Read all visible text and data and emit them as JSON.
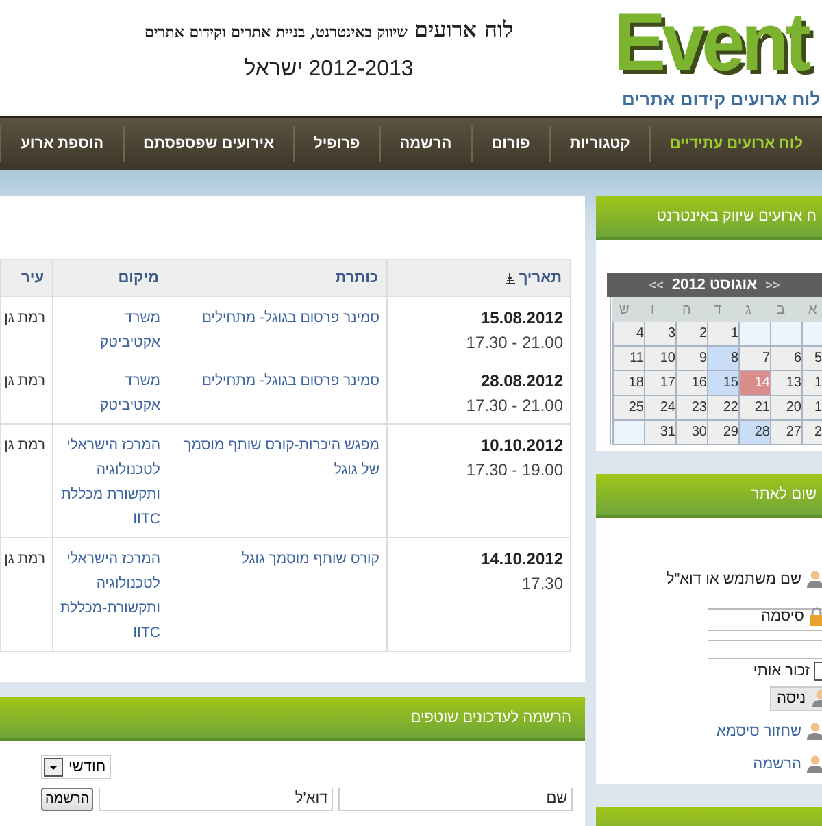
{
  "header": {
    "logo": "Event",
    "logo_subtitle": "לוח ארועים קידום אתרים",
    "title_main": "לוח ארועים",
    "title_rest": "שיווק באינטרנט, בניית אתרים וקידום אתרים",
    "subtitle": "2012-2013 ישראל"
  },
  "nav": [
    {
      "label": "לוח ארועים עתידיים",
      "selected": true
    },
    {
      "label": "קטגוריות",
      "selected": false
    },
    {
      "label": "פורום",
      "selected": false
    },
    {
      "label": "הרשמה",
      "selected": false
    },
    {
      "label": "פרופיל",
      "selected": false
    },
    {
      "label": "אירועים שפספסתם",
      "selected": false
    },
    {
      "label": "הוספת ארוע",
      "selected": false
    }
  ],
  "events_table": {
    "columns": [
      "תאריך",
      "כותרת",
      "מיקום",
      "עיר"
    ],
    "rows": [
      {
        "date": "15.08.2012",
        "time": "21.00 - 17.30",
        "title": "סמינר פרסום בגוגל- מתחילים",
        "location": "משרד אקטיביטק",
        "city": "רמת גן",
        "divider": false
      },
      {
        "date": "28.08.2012",
        "time": "21.00 - 17.30",
        "title": "סמינר פרסום בגוגל- מתחילים",
        "location": "משרד אקטיביטק",
        "city": "רמת גן",
        "divider": true
      },
      {
        "date": "10.10.2012",
        "time": "19.00 - 17.30",
        "title": "מפגש היכרות-קורס שותף מוסמך של גוגל",
        "location": "המרכז הישראלי לטכנולוגיה ותקשורת מכללת IITC",
        "city": "רמת גן",
        "divider": true
      },
      {
        "date": "14.10.2012",
        "time": "17.30",
        "title": "קורס שותף מוסמך גוגל",
        "location": "המרכז הישראלי לטכנולוגיה ותקשורת-מכללת IITC",
        "city": "רמת גן",
        "divider": true
      }
    ]
  },
  "newsletter": {
    "title": "הרשמה לעדכונים שוטפים",
    "frequency": "חודשי",
    "name_placeholder": "שם",
    "email_placeholder": "דוא'ל",
    "button": "הרשמה"
  },
  "calendar_panel": {
    "title": "ח ארועים שיווק באינטרנט",
    "nav_prev": "<<",
    "month": "אוגוסט 2012",
    "nav_next": ">>",
    "weekdays": [
      "א",
      "ב",
      "ג",
      "ד",
      "ה",
      "ו",
      "ש"
    ],
    "weeks": [
      [
        {
          "kind": "blank"
        },
        {
          "kind": "blank"
        },
        {
          "kind": "blank"
        },
        {
          "kind": "day",
          "text": "1"
        },
        {
          "kind": "day",
          "text": "2"
        },
        {
          "kind": "day",
          "text": "3"
        },
        {
          "kind": "day",
          "text": "4"
        }
      ],
      [
        {
          "kind": "day",
          "text": "5"
        },
        {
          "kind": "day",
          "text": "6"
        },
        {
          "kind": "day",
          "text": "7"
        },
        {
          "kind": "event",
          "text": "8"
        },
        {
          "kind": "day",
          "text": "9"
        },
        {
          "kind": "day",
          "text": "10"
        },
        {
          "kind": "day",
          "text": "11"
        }
      ],
      [
        {
          "kind": "day",
          "text": "1"
        },
        {
          "kind": "day",
          "text": "13"
        },
        {
          "kind": "today",
          "text": "14"
        },
        {
          "kind": "event",
          "text": "15"
        },
        {
          "kind": "day",
          "text": "16"
        },
        {
          "kind": "day",
          "text": "17"
        },
        {
          "kind": "day",
          "text": "18"
        }
      ],
      [
        {
          "kind": "day",
          "text": "1"
        },
        {
          "kind": "day",
          "text": "20"
        },
        {
          "kind": "day",
          "text": "21"
        },
        {
          "kind": "day",
          "text": "22"
        },
        {
          "kind": "day",
          "text": "23"
        },
        {
          "kind": "day",
          "text": "24"
        },
        {
          "kind": "day",
          "text": "25"
        }
      ],
      [
        {
          "kind": "day",
          "text": "2"
        },
        {
          "kind": "day",
          "text": "27"
        },
        {
          "kind": "event",
          "text": "28"
        },
        {
          "kind": "day",
          "text": "29"
        },
        {
          "kind": "day",
          "text": "30"
        },
        {
          "kind": "day",
          "text": "31"
        },
        {
          "kind": "blank"
        }
      ]
    ]
  },
  "login_panel": {
    "title": "שום לאתר",
    "username_label": "שם משתמש או דוא\"ל",
    "password_label": "סיסמה",
    "remember_label": "זכור אותי",
    "remember_checked": false,
    "login_button": "ניסה",
    "links": [
      "שחזור סיסמא",
      "הרשמה"
    ]
  }
}
